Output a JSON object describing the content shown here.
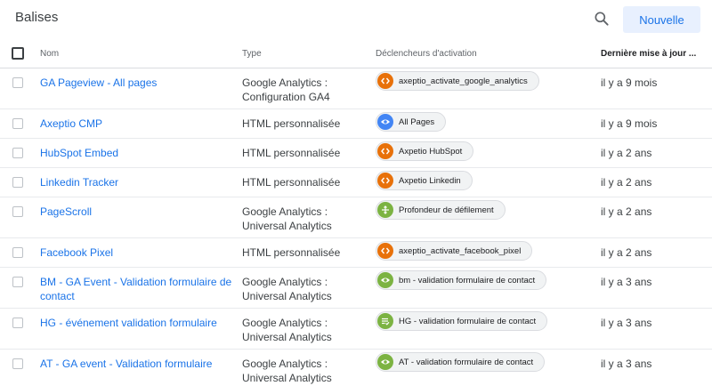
{
  "header": {
    "title": "Balises",
    "new_button": "Nouvelle"
  },
  "columns": {
    "name": "Nom",
    "type": "Type",
    "triggers": "Déclencheurs d'activation",
    "date": "Dernière mise à jour ..."
  },
  "colors": {
    "html": "#e8710a",
    "pageview": "#4285f4",
    "scroll": "#7cb342",
    "event": "#7cb342",
    "link": "#1a73e8"
  },
  "rows": [
    {
      "name": "GA Pageview - All pages",
      "type": "Google Analytics : Configuration GA4",
      "trigger": "axeptio_activate_google_analytics",
      "trigger_icon": "code-icon",
      "date": "il y a 9 mois"
    },
    {
      "name": "Axeptio CMP",
      "type": "HTML personnalisée",
      "trigger": "All Pages",
      "trigger_icon": "eye-icon",
      "date": "il y a 9 mois"
    },
    {
      "name": "HubSpot Embed",
      "type": "HTML personnalisée",
      "trigger": "Axpetio HubSpot",
      "trigger_icon": "code-icon",
      "date": "il y a 2 ans"
    },
    {
      "name": "Linkedin Tracker",
      "type": "HTML personnalisée",
      "trigger": "Axpetio Linkedin",
      "trigger_icon": "code-icon",
      "date": "il y a 2 ans"
    },
    {
      "name": "PageScroll",
      "type": "Google Analytics : Universal Analytics",
      "trigger": "Profondeur de défilement",
      "trigger_icon": "scroll-icon",
      "date": "il y a 2 ans"
    },
    {
      "name": "Facebook Pixel",
      "type": "HTML personnalisée",
      "trigger": "axeptio_activate_facebook_pixel",
      "trigger_icon": "code-icon",
      "date": "il y a 2 ans"
    },
    {
      "name": "BM - GA Event - Validation formulaire de contact",
      "type": "Google Analytics : Universal Analytics",
      "trigger": "bm - validation formulaire de contact",
      "trigger_icon": "eye-icon",
      "date": "il y a 3 ans"
    },
    {
      "name": "HG - événement validation formulaire",
      "type": "Google Analytics : Universal Analytics",
      "trigger": "HG - validation formulaire de contact",
      "trigger_icon": "form-icon",
      "date": "il y a 3 ans"
    },
    {
      "name": "AT - GA event - Validation formulaire",
      "type": "Google Analytics : Universal Analytics",
      "trigger": "AT - validation formulaire de contact",
      "trigger_icon": "eye-icon",
      "date": "il y a 3 ans"
    }
  ]
}
